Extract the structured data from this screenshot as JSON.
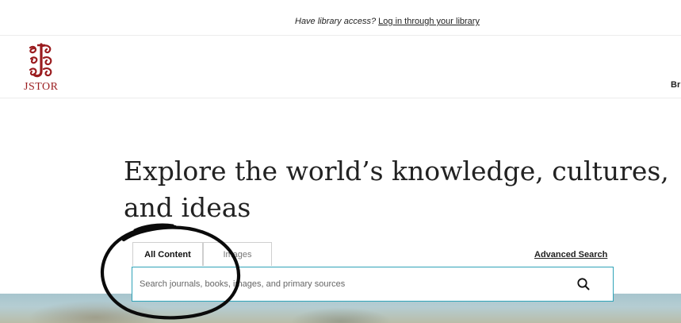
{
  "topbar": {
    "prompt": "Have library access?",
    "link": "Log in through your library"
  },
  "header": {
    "logo_text": "JSTOR",
    "nav_stub": "Br"
  },
  "hero": {
    "title_line1": "Explore the world’s knowledge, cultures,",
    "title_line2": "and ideas"
  },
  "search": {
    "tabs": [
      {
        "label": "All Content",
        "active": true
      },
      {
        "label": "Images",
        "active": false
      }
    ],
    "advanced_label": "Advanced Search",
    "placeholder": "Search journals, books, images, and primary sources",
    "value": "",
    "button_icon": "search-icon"
  },
  "colors": {
    "brand_red": "#9a1b1e",
    "search_border": "#2fa3b8"
  }
}
